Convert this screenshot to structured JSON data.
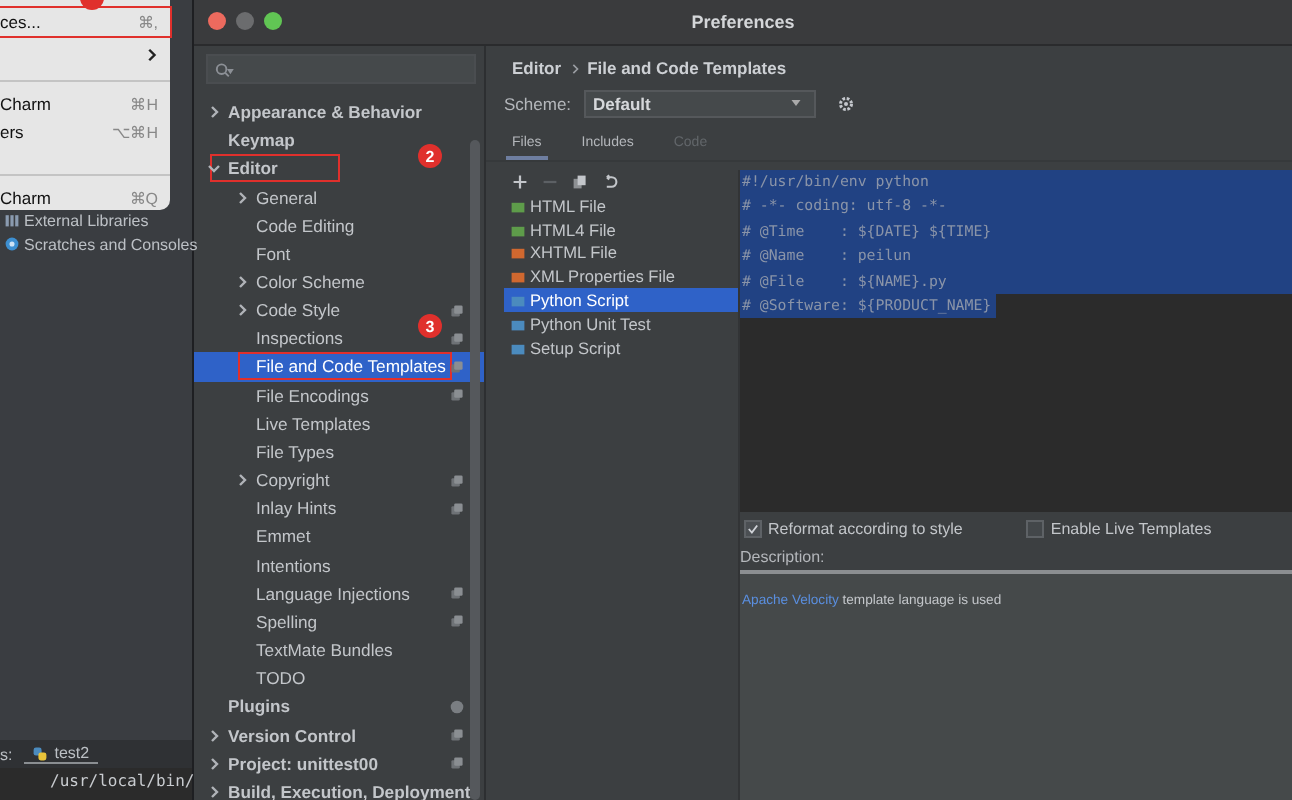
{
  "ide": {
    "menu": {
      "items": [
        {
          "kind": "item",
          "label": "ces...",
          "shortcut": "⌘,",
          "boxed": true,
          "marker_cut": true
        },
        {
          "kind": "submenu"
        },
        {
          "kind": "separator"
        },
        {
          "kind": "item",
          "label": "Charm",
          "shortcut": "⌘H",
          "boxed": false,
          "marker_cut": false
        },
        {
          "kind": "item",
          "label": "ers",
          "shortcut": "⌥⌘H",
          "boxed": false,
          "marker_cut": false
        },
        {
          "kind": "spacer"
        },
        {
          "kind": "separator"
        },
        {
          "kind": "item",
          "label": "Charm",
          "shortcut": "⌘Q",
          "boxed": false,
          "marker_cut": false
        }
      ]
    },
    "project_tree": [
      {
        "label": "External Libraries",
        "kind": "library"
      },
      {
        "label": "Scratches and Consoles",
        "kind": "scratch"
      }
    ],
    "run_label": "s:",
    "run_tab": "test2",
    "console_line": "/usr/local/bin/"
  },
  "window": {
    "title": "Preferences",
    "sidebar": {
      "items": [
        {
          "label": "Appearance & Behavior",
          "expanded": false
        },
        {
          "label": "Keymap"
        },
        {
          "label": "Editor",
          "expanded": true,
          "boxed": true,
          "marker": "2",
          "children": [
            {
              "label": "General",
              "expanded": false
            },
            {
              "label": "Code Editing"
            },
            {
              "label": "Font"
            },
            {
              "label": "Color Scheme",
              "expanded": false
            },
            {
              "label": "Code Style",
              "expanded": false,
              "scoped": true
            },
            {
              "label": "Inspections",
              "scoped": true,
              "marker": "3"
            },
            {
              "label": "File and Code Templates",
              "scoped": true,
              "selected": true,
              "boxed": true
            },
            {
              "label": "File Encodings",
              "scoped": true
            },
            {
              "label": "Live Templates"
            },
            {
              "label": "File Types"
            },
            {
              "label": "Copyright",
              "expanded": false,
              "scoped": true
            },
            {
              "label": "Inlay Hints",
              "scoped": true
            },
            {
              "label": "Emmet"
            },
            {
              "label": "Intentions"
            },
            {
              "label": "Language Injections",
              "scoped": true
            },
            {
              "label": "Spelling",
              "scoped": true
            },
            {
              "label": "TextMate Bundles"
            },
            {
              "label": "TODO"
            }
          ]
        },
        {
          "label": "Plugins",
          "badge": true
        },
        {
          "label": "Version Control",
          "expanded": false,
          "scoped": true
        },
        {
          "label": "Project: unittest00",
          "expanded": false,
          "scoped": true
        },
        {
          "label": "Build, Execution, Deployment",
          "expanded": false
        }
      ]
    },
    "breadcrumb": [
      "Editor",
      "File and Code Templates"
    ],
    "scheme": {
      "label": "Scheme:",
      "value": "Default"
    },
    "tabs": [
      {
        "label": "Files",
        "selected": true,
        "disabled": false
      },
      {
        "label": "Includes",
        "selected": false,
        "disabled": false
      },
      {
        "label": "Code",
        "selected": false,
        "disabled": true
      }
    ],
    "toolbar": [
      {
        "kind": "add",
        "disabled": false
      },
      {
        "kind": "remove",
        "disabled": true
      },
      {
        "kind": "copy",
        "disabled": false
      },
      {
        "kind": "reset",
        "disabled": false
      }
    ],
    "templates": [
      {
        "label": "HTML File",
        "color": "#5e9c4a",
        "selected": false
      },
      {
        "label": "HTML4 File",
        "color": "#5e9c4a",
        "selected": false
      },
      {
        "label": "XHTML File",
        "color": "#d0682f",
        "selected": false
      },
      {
        "label": "XML Properties File",
        "color": "#d0682f",
        "selected": false
      },
      {
        "label": "Python Script",
        "color": "#4b8bbe",
        "selected": true
      },
      {
        "label": "Python Unit Test",
        "color": "#4b8bbe",
        "selected": false
      },
      {
        "label": "Setup Script",
        "color": "#4b8bbe",
        "selected": false
      }
    ],
    "code_lines": [
      {
        "text": "#!/usr/bin/env python",
        "selected": true
      },
      {
        "text": "# -*- coding: utf-8 -*-",
        "selected": true
      },
      {
        "text": "# @Time    : ${DATE} ${TIME}",
        "selected": true
      },
      {
        "text": "# @Name    : peilun",
        "selected": true
      },
      {
        "text": "# @File    : ${NAME}.py",
        "selected": true
      },
      {
        "text": "# @Software: ${PRODUCT_NAME}",
        "selected": true
      }
    ],
    "options": [
      {
        "label": "Reformat according to style",
        "checked": true
      },
      {
        "label": "Enable Live Templates",
        "checked": false
      }
    ],
    "description": {
      "label": "Description:",
      "link": "Apache Velocity",
      "text": " template language is used"
    }
  }
}
